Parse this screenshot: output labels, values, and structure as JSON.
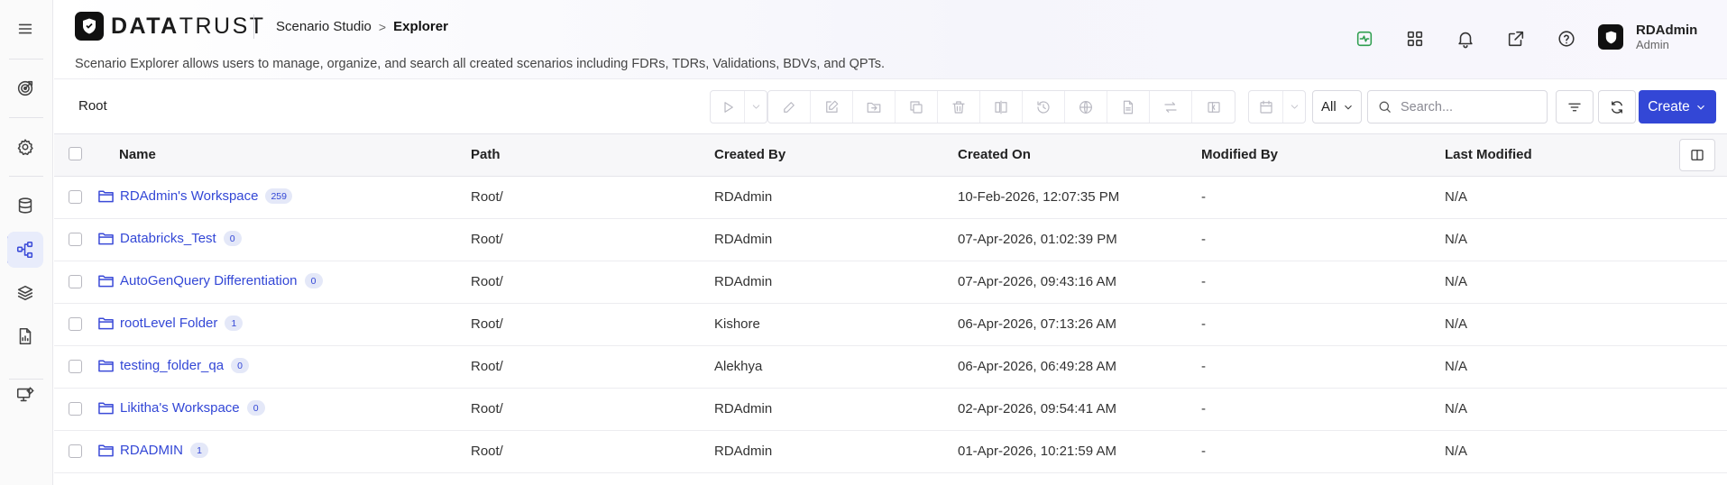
{
  "brand": {
    "name_bold": "DATA",
    "name_light": "TRUST"
  },
  "breadcrumb": {
    "parent": "Scenario Studio",
    "current": "Explorer"
  },
  "description": "Scenario Explorer allows users to manage, organize, and search all created scenarios including FDRs, TDRs, Validations, BDVs, and QPTs.",
  "user": {
    "name": "RDAdmin",
    "role": "Admin"
  },
  "toolbar": {
    "root_label": "Root",
    "filter_value": "All",
    "search_placeholder": "Search...",
    "create_label": "Create"
  },
  "table": {
    "columns": {
      "name": "Name",
      "path": "Path",
      "created_by": "Created By",
      "created_on": "Created On",
      "modified_by": "Modified By",
      "last_modified": "Last Modified"
    },
    "rows": [
      {
        "name": "RDAdmin's Workspace",
        "count": "259",
        "path": "Root/",
        "created_by": "RDAdmin",
        "created_on": "10-Feb-2026, 12:07:35 PM",
        "modified_by": "-",
        "last_modified": "N/A"
      },
      {
        "name": "Databricks_Test",
        "count": "0",
        "path": "Root/",
        "created_by": "RDAdmin",
        "created_on": "07-Apr-2026, 01:02:39 PM",
        "modified_by": "-",
        "last_modified": "N/A"
      },
      {
        "name": "AutoGenQuery Differentiation",
        "count": "0",
        "path": "Root/",
        "created_by": "RDAdmin",
        "created_on": "07-Apr-2026, 09:43:16 AM",
        "modified_by": "-",
        "last_modified": "N/A"
      },
      {
        "name": "rootLevel Folder",
        "count": "1",
        "path": "Root/",
        "created_by": "Kishore",
        "created_on": "06-Apr-2026, 07:13:26 AM",
        "modified_by": "-",
        "last_modified": "N/A"
      },
      {
        "name": "testing_folder_qa",
        "count": "0",
        "path": "Root/",
        "created_by": "Alekhya",
        "created_on": "06-Apr-2026, 06:49:28 AM",
        "modified_by": "-",
        "last_modified": "N/A"
      },
      {
        "name": "Likitha's Workspace",
        "count": "0",
        "path": "Root/",
        "created_by": "RDAdmin",
        "created_on": "02-Apr-2026, 09:54:41 AM",
        "modified_by": "-",
        "last_modified": "N/A"
      },
      {
        "name": "RDADMIN",
        "count": "1",
        "path": "Root/",
        "created_by": "RDAdmin",
        "created_on": "01-Apr-2026, 10:21:59 AM",
        "modified_by": "-",
        "last_modified": "N/A"
      }
    ]
  },
  "colors": {
    "accent": "#3347d6",
    "active_nav_bg": "#e8ecfb",
    "badge_bg": "#e4e8f8",
    "health_icon": "#2e9e4f"
  }
}
